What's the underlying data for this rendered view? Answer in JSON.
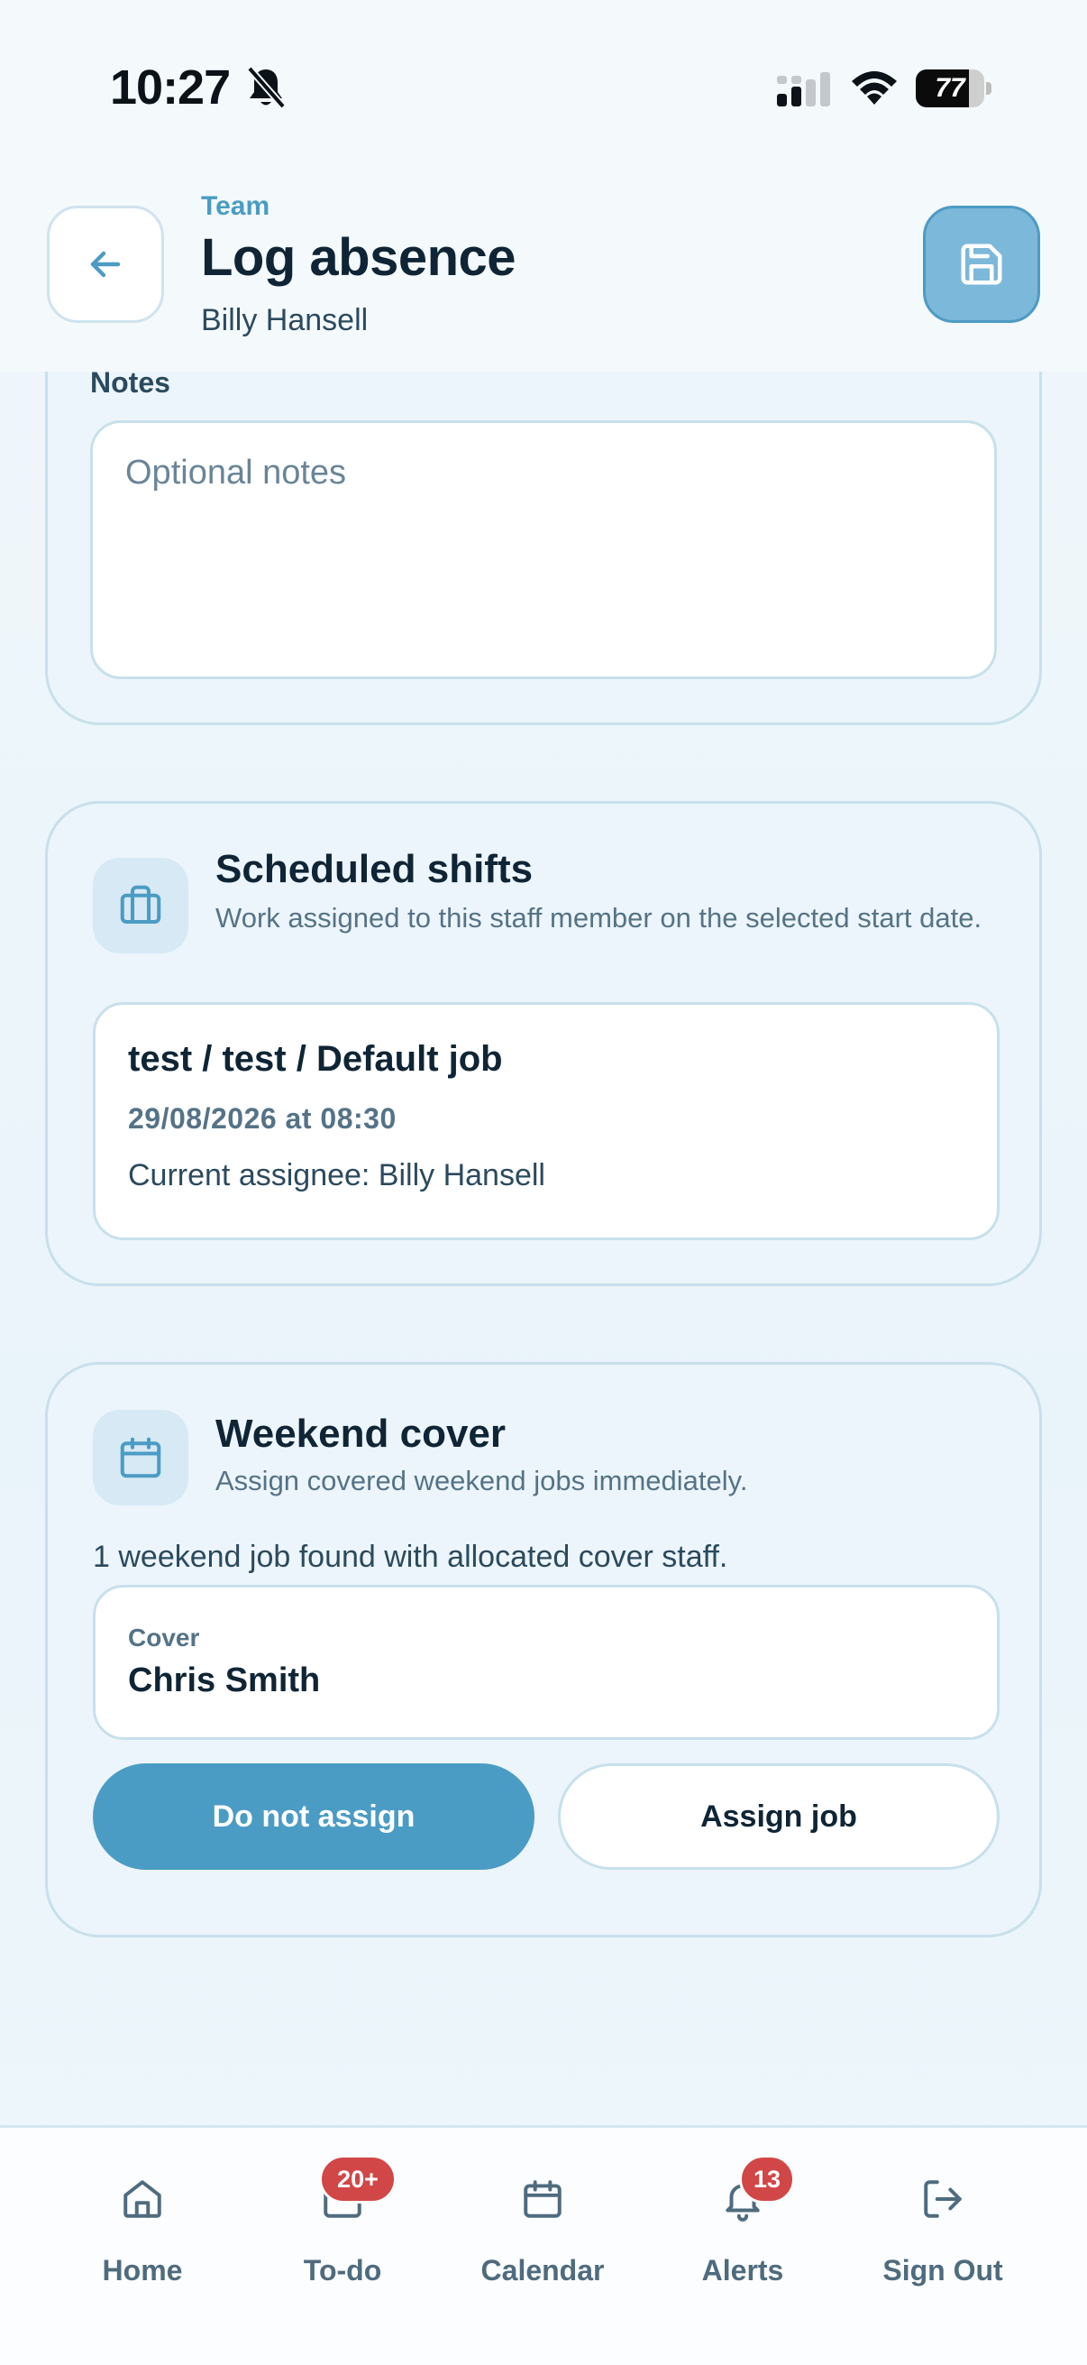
{
  "status_bar": {
    "time": "10:27",
    "battery_percent": "77",
    "battery_level": 0.77
  },
  "header": {
    "kicker": "Team",
    "title": "Log absence",
    "subtitle": "Billy Hansell"
  },
  "notes": {
    "label": "Notes",
    "placeholder": "Optional notes"
  },
  "scheduled_shifts": {
    "title": "Scheduled shifts",
    "description": "Work assigned to this staff member on the selected start date.",
    "shifts": [
      {
        "title": "test / test / Default job",
        "date": "29/08/2026 at 08:30",
        "assignee": "Current assignee: Billy Hansell"
      }
    ]
  },
  "weekend_cover": {
    "title": "Weekend cover",
    "description": "Assign covered weekend jobs immediately.",
    "found_text": "1 weekend job found with allocated cover staff.",
    "cover_label": "Cover",
    "cover_name": "Chris Smith",
    "do_not_assign_label": "Do not assign",
    "assign_label": "Assign job"
  },
  "tab_bar": {
    "items": [
      {
        "label": "Home",
        "icon": "home-icon"
      },
      {
        "label": "To-do",
        "icon": "todo-icon",
        "badge": "20+"
      },
      {
        "label": "Calendar",
        "icon": "calendar-icon"
      },
      {
        "label": "Alerts",
        "icon": "bell-icon",
        "badge": "13"
      },
      {
        "label": "Sign Out",
        "icon": "sign-out-icon"
      }
    ]
  },
  "colors": {
    "accent": "#4b9cc4",
    "save_button": "#7cb8d9",
    "badge": "#d14747",
    "text_dark": "#0f2535"
  }
}
